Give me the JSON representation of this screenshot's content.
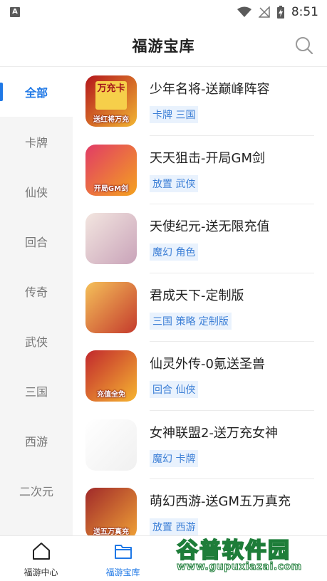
{
  "status_bar": {
    "time": "8:51",
    "notification_icon_letter": "A"
  },
  "header": {
    "title": "福游宝库",
    "search_icon": "search-icon"
  },
  "sidebar": {
    "items": [
      {
        "label": "全部",
        "active": true
      },
      {
        "label": "卡牌",
        "active": false
      },
      {
        "label": "仙侠",
        "active": false
      },
      {
        "label": "回合",
        "active": false
      },
      {
        "label": "传奇",
        "active": false
      },
      {
        "label": "武侠",
        "active": false
      },
      {
        "label": "三国",
        "active": false
      },
      {
        "label": "西游",
        "active": false
      },
      {
        "label": "二次元",
        "active": false
      }
    ]
  },
  "games": [
    {
      "name": "少年名将-送巅峰阵容",
      "tags": "卡牌 三国",
      "icon_text": "万充卡",
      "icon_sub": "送红将万充",
      "colors": [
        "#b3151b",
        "#f2b632"
      ]
    },
    {
      "name": "天天狙击-开局GM剑",
      "tags": "放置 武侠",
      "icon_text": "",
      "icon_sub": "开局GM剑",
      "colors": [
        "#e13b66",
        "#f4a21f"
      ]
    },
    {
      "name": "天使纪元-送无限充值",
      "tags": "魔幻 角色",
      "icon_text": "",
      "icon_sub": "",
      "colors": [
        "#f3e6e0",
        "#c9a3b9"
      ]
    },
    {
      "name": "君成天下-定制版",
      "tags": "三国 策略 定制版",
      "icon_text": "",
      "icon_sub": "",
      "colors": [
        "#f5c15a",
        "#c43a2c"
      ]
    },
    {
      "name": "仙灵外传-0氪送圣兽",
      "tags": "回合 仙侠",
      "icon_text": "",
      "icon_sub": "充值全免",
      "colors": [
        "#c1272d",
        "#f6b531"
      ]
    },
    {
      "name": "女神联盟2-送万充女神",
      "tags": "魔幻 卡牌",
      "icon_text": "",
      "icon_sub": "",
      "colors": [
        "#ffffff",
        "#f0f0f0"
      ]
    },
    {
      "name": "萌幻西游-送GM五万真充",
      "tags": "放置 西游",
      "icon_text": "",
      "icon_sub": "送五万真充",
      "colors": [
        "#a0292a",
        "#f0a236"
      ]
    }
  ],
  "tabbar": {
    "tabs": [
      {
        "label": "福游中心",
        "icon": "home-icon",
        "active": false
      },
      {
        "label": "福游宝库",
        "icon": "folder-icon",
        "active": true
      }
    ]
  },
  "watermark": {
    "main": "谷普软件园",
    "url": "www.gupuxiazai.com"
  }
}
